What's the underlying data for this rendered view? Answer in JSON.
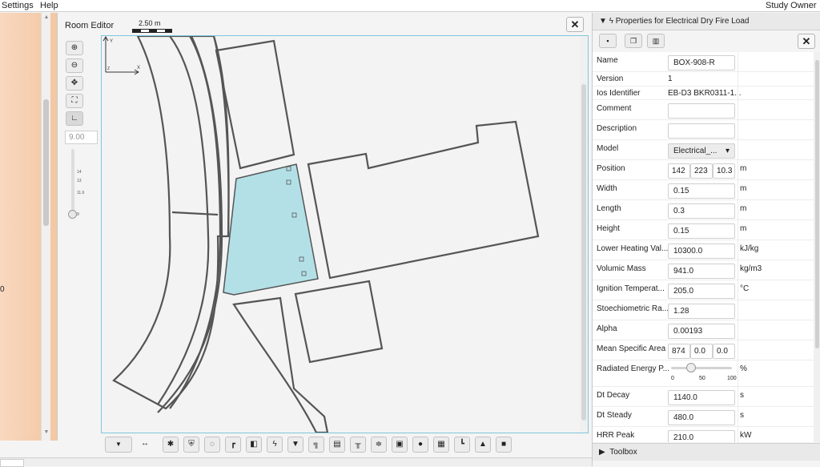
{
  "menubar": {
    "items": [
      "Settings",
      "Help"
    ],
    "user": "Study Owner"
  },
  "left_panel": {
    "value": "0"
  },
  "room_editor": {
    "title": "Room Editor",
    "scale_label": "2.50 m",
    "zoom_value": "9.00",
    "slider_ticks": [
      "14",
      "13",
      "11.6",
      "9"
    ],
    "axis": {
      "y": "Y",
      "x": "X",
      "z": "Z"
    },
    "tool_icons": [
      "zoom-in-icon",
      "zoom-out-icon",
      "pan-icon",
      "fit-icon",
      "corner-icon"
    ],
    "bottom_icons": [
      "dropdown-icon",
      "resize-icon",
      "fan-icon",
      "shield-icon",
      "circle-dashed-icon",
      "sprinkler-icon",
      "door-icon",
      "lightning-icon",
      "filter-icon",
      "chair-icon",
      "cabinet-icon",
      "table-icon",
      "sliders-icon",
      "pump-icon",
      "drop-icon",
      "grid-icon",
      "pipe-icon",
      "triangle-icon",
      "lock-icon"
    ]
  },
  "properties": {
    "header": "Properties for Electrical Dry Fire Load",
    "toolbox": "Toolbox",
    "rows": [
      {
        "key": "Name",
        "value": "BOX-908-R",
        "type": "field"
      },
      {
        "key": "Version",
        "value": "1",
        "type": "text"
      },
      {
        "key": "Ios Identifier",
        "value": "EB-D3 BKR0311-1...",
        "type": "text"
      },
      {
        "key": "Comment",
        "value": "",
        "type": "field"
      },
      {
        "key": "Description",
        "value": "",
        "type": "field"
      },
      {
        "key": "Model",
        "value": "Electrical_...",
        "type": "select"
      },
      {
        "key": "Position",
        "value": [
          "142",
          "223",
          "10.3"
        ],
        "unit": "m",
        "type": "triple"
      },
      {
        "key": "Width",
        "value": "0.15",
        "unit": "m",
        "type": "field"
      },
      {
        "key": "Length",
        "value": "0.3",
        "unit": "m",
        "type": "field"
      },
      {
        "key": "Height",
        "value": "0.15",
        "unit": "m",
        "type": "field"
      },
      {
        "key": "Lower Heating Val...",
        "value": "10300.0",
        "unit": "kJ/kg",
        "type": "field"
      },
      {
        "key": "Volumic Mass",
        "value": "941.0",
        "unit": "kg/m3",
        "type": "field"
      },
      {
        "key": "Ignition Temperat...",
        "value": "205.0",
        "unit": "°C",
        "type": "field"
      },
      {
        "key": "Stoechiometric Ra...",
        "value": "1.28",
        "type": "field"
      },
      {
        "key": "Alpha",
        "value": "0.00193",
        "type": "field"
      },
      {
        "key": "Mean Specific Area",
        "value": [
          "874",
          "0.0",
          "0.0"
        ],
        "type": "triple"
      },
      {
        "key": "Radiated Energy P...",
        "value": [
          "0",
          "50",
          "100"
        ],
        "unit": "%",
        "type": "slider",
        "level": 0.33
      },
      {
        "key": "Dt Decay",
        "value": "1140.0",
        "unit": "s",
        "type": "field"
      },
      {
        "key": "Dt Steady",
        "value": "480.0",
        "unit": "s",
        "type": "field"
      },
      {
        "key": "HRR Peak",
        "value": "210.0",
        "unit": "kW",
        "type": "field"
      }
    ]
  }
}
